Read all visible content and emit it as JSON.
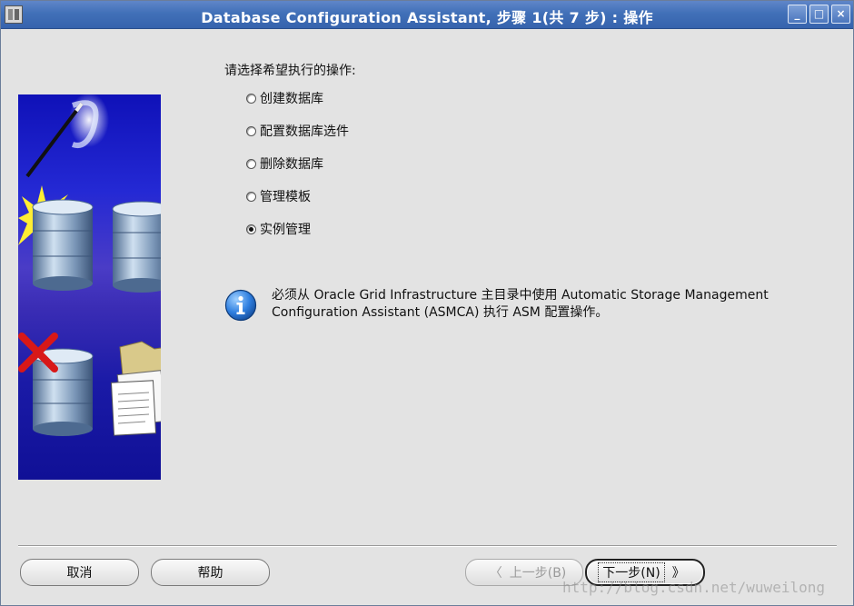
{
  "window": {
    "title": "Database Configuration Assistant, 步骤 1(共 7 步) : 操作",
    "controls": {
      "minimize": "_",
      "maximize": "□",
      "close": "×"
    }
  },
  "prompt": "请选择希望执行的操作:",
  "options": [
    {
      "label": "创建数据库",
      "selected": false
    },
    {
      "label": "配置数据库选件",
      "selected": false
    },
    {
      "label": "删除数据库",
      "selected": false
    },
    {
      "label": "管理模板",
      "selected": false
    },
    {
      "label": "实例管理",
      "selected": true
    }
  ],
  "info": {
    "icon": "info-icon",
    "line1": "必须从 Oracle Grid Infrastructure 主目录中使用 Automatic Storage Management",
    "line2": "Configuration Assistant (ASMCA) 执行 ASM 配置操作。"
  },
  "buttons": {
    "cancel": "取消",
    "help": "帮助",
    "back": "上一步(B)",
    "back_chevron": "〈",
    "next": "下一步(N)",
    "next_chevron": "》"
  },
  "watermark": "http://blog.csdn.net/wuweilong",
  "colors": {
    "titlebar": "#4170b8",
    "background": "#e3e3e3",
    "art_background": "#1a1aa6"
  }
}
